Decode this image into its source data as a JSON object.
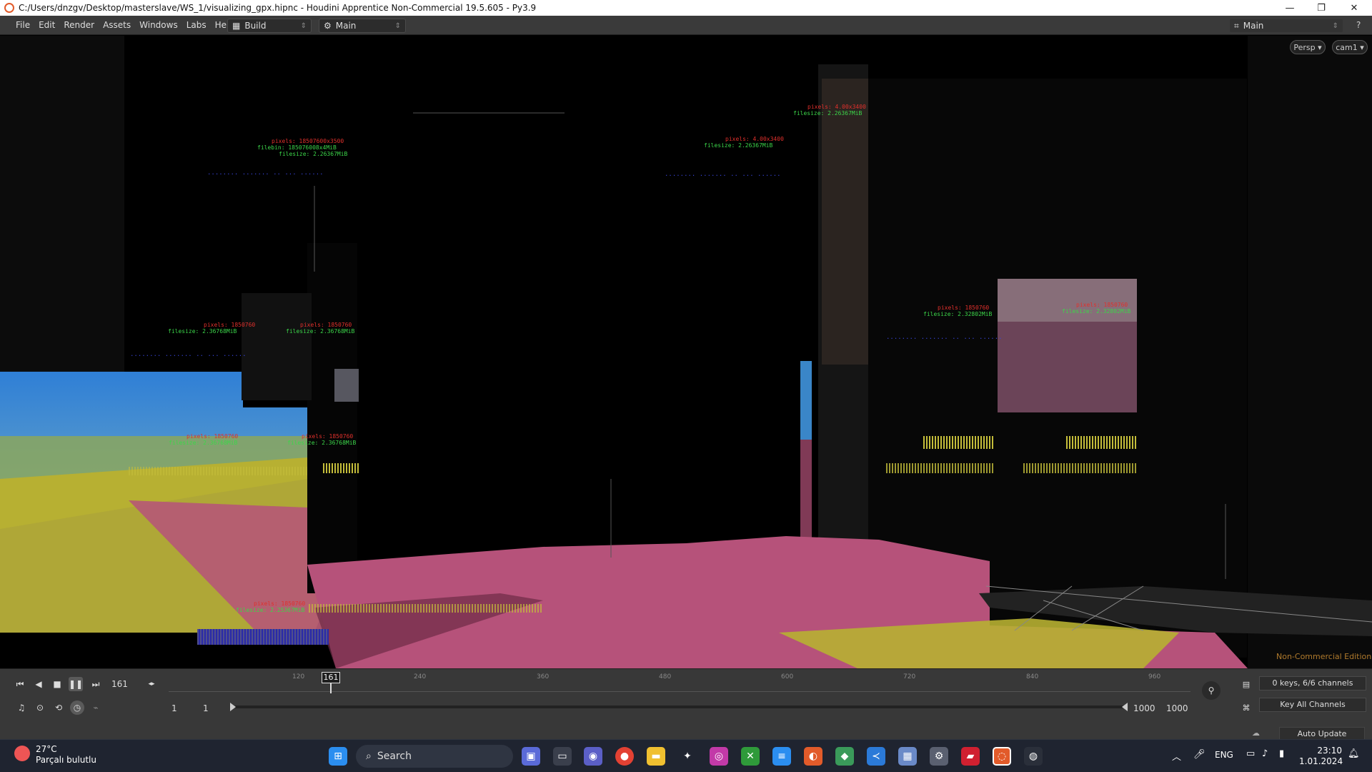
{
  "window": {
    "title": "C:/Users/dnzgv/Desktop/masterslave/WS_1/visualizing_gpx.hipnc - Houdini Apprentice Non-Commercial 19.5.605 - Py3.9",
    "minimize": "—",
    "restore": "❐",
    "close": "✕"
  },
  "menu": [
    "File",
    "Edit",
    "Render",
    "Assets",
    "Windows",
    "Labs",
    "Help"
  ],
  "desktops": {
    "build": "Build",
    "main_left": "Main",
    "main_right": "Main"
  },
  "viewport": {
    "persp": "Persp ▾",
    "cam": "cam1 ▾",
    "watermark": "Non-Commercial Edition",
    "labels": [
      {
        "r": "pixels: 18507600x3500",
        "g": "filebin: 185076008x4MiB",
        "g2": "filesize: 2.26367MiB",
        "b": "........ ....... .. ... ......"
      },
      {
        "r": "pixels: 4.00x3400",
        "g": "filesize: 2.26367MiB"
      },
      {
        "r": "pixels: 1850760",
        "g": "filesize: 2.36768MiB"
      },
      {
        "r": "pixels: 1850760",
        "g": "filesize: 2.36768MiB"
      },
      {
        "r": "pixels: 1850760",
        "g": "filesize: 2.36768MiB"
      },
      {
        "r": "pixels: 1850760",
        "g": "filesize: 2.36768MiB"
      },
      {
        "r": "pixels: 1850760",
        "g": "filesize: 2.32802MiB"
      },
      {
        "r": "pixels: 1850760",
        "g": "filesize: 2.32802MiB"
      },
      {
        "r": "pixels: 1850760",
        "g": "filesize: 2.25367MiB"
      }
    ]
  },
  "timeline": {
    "frame": "161",
    "current_marker": "161",
    "ticks": [
      "120",
      "240",
      "360",
      "480",
      "600",
      "720",
      "840",
      "960"
    ],
    "start": "1",
    "start2": "1",
    "end": "1000",
    "end2": "1000",
    "keys": "0 keys, 6/6 channels",
    "key_all": "Key All Channels",
    "auto_update": "Auto Update"
  },
  "taskbar": {
    "temp": "27°C",
    "weather": "Parçalı bulutlu",
    "search": "Search",
    "lang": "ENG",
    "time": "23:10",
    "date": "1.01.2024"
  },
  "colors": {
    "accent": "#e25b2a",
    "terrain_pink": "#b6527a",
    "terrain_yellow": "#b7b032",
    "sky_blue": "#2f7fd6"
  }
}
